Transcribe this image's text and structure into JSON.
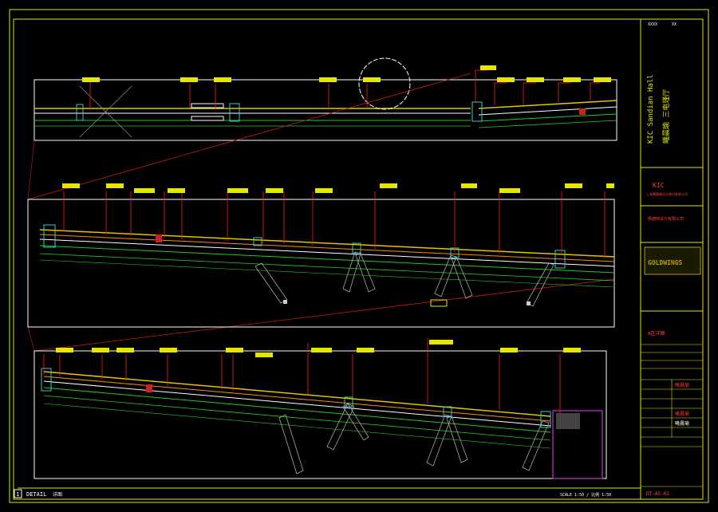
{
  "colors": {
    "background": "#000000",
    "frame": "#e6e600",
    "outline": "#ffffff",
    "leader": "#ff1a1a",
    "tag_fill": "#e6e600",
    "tag_text": "#000000",
    "dim": "#22cc22",
    "magenta": "#cc33cc",
    "cyan": "#33cccc"
  },
  "title_block": {
    "project_vertical_en": "KIC Sandian Hall",
    "project_vertical_cn": "曦晨瑜 三电瑾厅",
    "firm_code": "KIC",
    "firm_name_cn": "上海曦晨瑜设计顾问有限公司",
    "consultant_cn": "杨德绵设计有限公司",
    "logo_text": "GOLDWINGS",
    "drawing_title": "A区详图",
    "stamp_1": "曦晨瑜",
    "stamp_2": "曦晨瑜",
    "stamp_3": "曦晨瑜",
    "top_label_left": "XXXX",
    "top_label_right": "XX",
    "sheet_no": "DT-A5-02"
  },
  "footer": {
    "number": "1",
    "label": "DETAIL",
    "sub": "详图",
    "scale": "SCALE 1:50 / 比例 1:50"
  },
  "diagram": {
    "section_tags_top": [
      "1",
      "2",
      "3",
      "4",
      "5",
      "6",
      "7",
      "8",
      "9",
      "10",
      "11"
    ],
    "section_tags_mid": [
      "1",
      "2",
      "3",
      "4",
      "5",
      "6",
      "7",
      "8",
      "9",
      "10",
      "11",
      "12",
      "13",
      "14",
      "15",
      "16"
    ],
    "section_tags_bot": [
      "1",
      "2",
      "3",
      "4",
      "5",
      "6",
      "7",
      "8",
      "9",
      "10",
      "11",
      "12",
      "13",
      "14",
      "15"
    ]
  }
}
